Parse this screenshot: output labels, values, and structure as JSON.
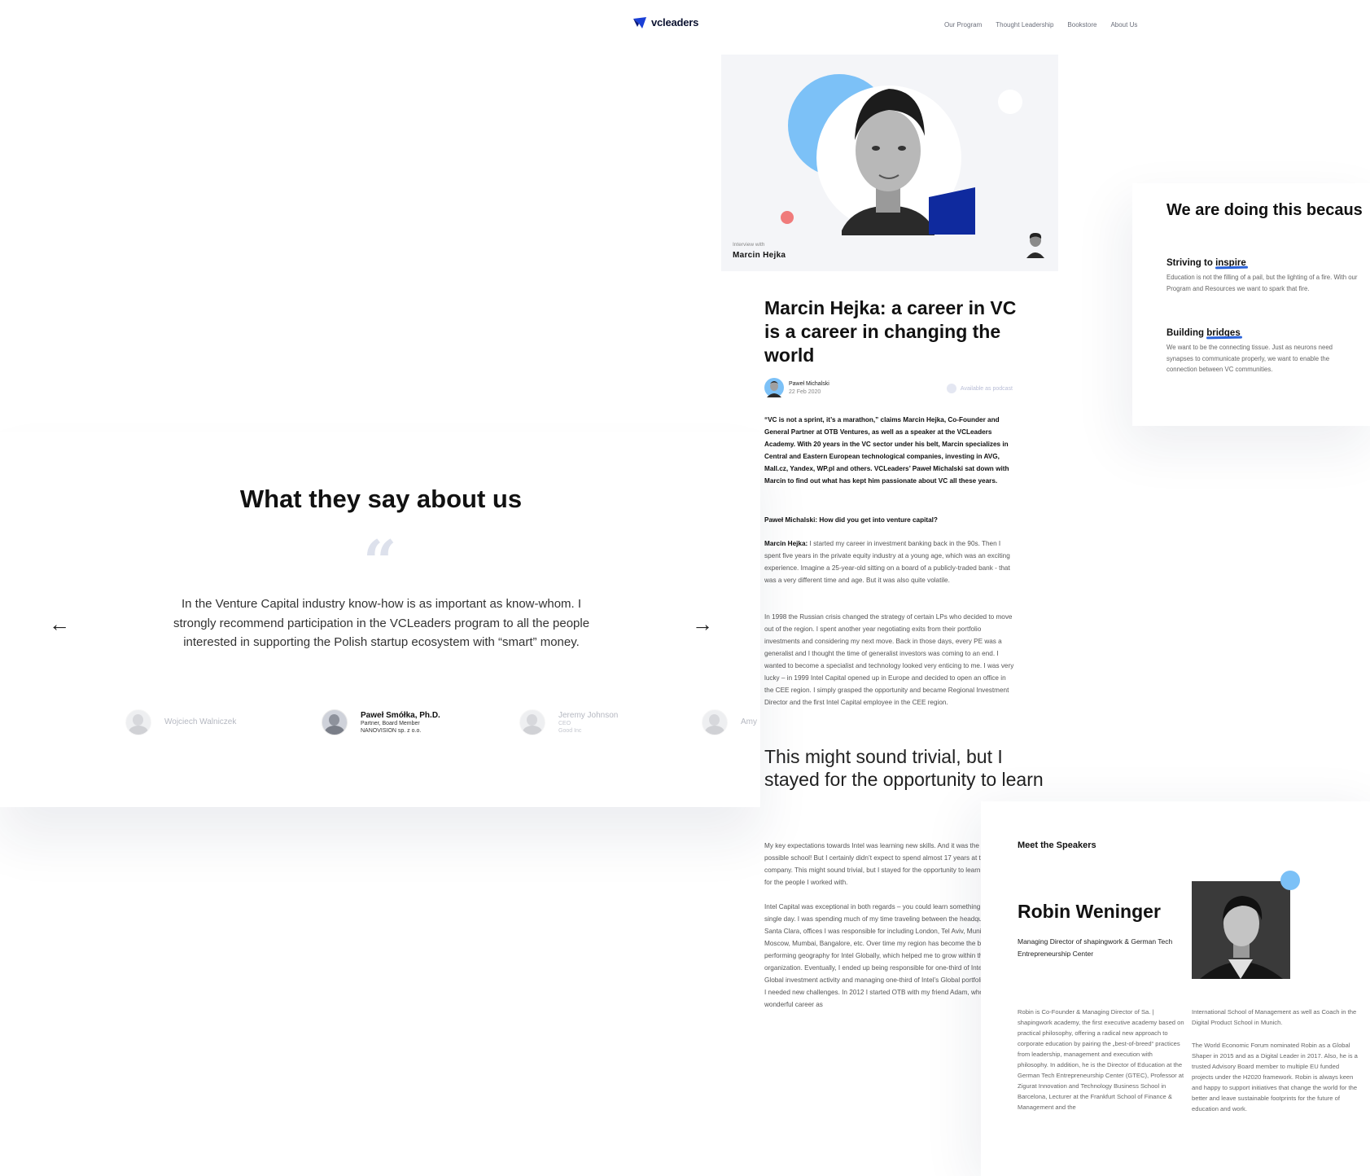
{
  "nav": {
    "brand": "vcleaders",
    "items": [
      "Our Program",
      "Thought Leadership",
      "Bookstore",
      "About Us"
    ]
  },
  "hero": {
    "label": "Interview with",
    "name": "Marcin Hejka"
  },
  "article": {
    "title": "Marcin Hejka: a career in VC is a career in changing the world",
    "author": "Paweł Michalski",
    "date": "22 Feb 2020",
    "podcast": "Available as podcast",
    "lead": "“VC is not a sprint, it’s a marathon,” claims Marcin Hejka, Co-Founder and General Partner at OTB Ventures, as well as a speaker at the VCLeaders Academy. With 20 years in the VC sector under his belt, Marcin specializes in Central and Eastern European technological companies, investing in AVG, Mall.cz, Yandex, WP.pl and others. VCLeaders’ Paweł Michalski sat down with Marcin to find out what has kept him passionate about VC all these years.",
    "question": "Paweł Michalski: How did you get into venture capital?",
    "answer_speaker": "Marcin Hejka:",
    "answer": " I started my career in investment banking back in the 90s. Then I spent five years in the private equity industry at a young age, which was an exciting experience. Imagine a 25-year-old sitting on a board of a publicly-traded bank - that was a very different time and age. But it was also quite volatile.",
    "para2": "In 1998 the Russian crisis changed the strategy of certain LPs who decided to move out of the region. I spent another year negotiating exits from their portfolio investments and considering my next move. Back in those days, every PE was a generalist and I thought the time of generalist investors was coming to an end. I wanted to become a specialist and technology looked very enticing to me. I was very lucky – in 1999 Intel Capital opened up in Europe and decided to open an office in the CEE region. I simply grasped the opportunity and became Regional Investment Director and the first Intel Capital employee in the CEE region.",
    "pull_quote": "This might sound trivial, but I stayed for the opportunity to learn",
    "para3": "My key expectations towards Intel was learning new skills. And it was the best possible school! But I certainly didn’t expect to spend almost 17 years at the company. This might sound trivial, but I stayed for the opportunity to learn and then for the people I worked with.",
    "para4": "Intel Capital was exceptional in both regards – you could learn something new every single day. I was spending much of my time traveling between the headquarters in Santa Clara, offices I was responsible for including London, Tel Aviv, Munich, Moscow, Mumbai, Bangalore, etc. Over time my region has become the best performing geography for Intel Globally, which helped me to grow within the organization. Eventually, I ended up being responsible for one-third of Intel Capital’s Global investment activity and managing one-third of Intel’s Global portfolio. I decided I needed new challenges. In 2012 I started OTB with my friend Adam, who had a wonderful career as"
  },
  "testimonials": {
    "title": "What they say about us",
    "quote_mark": "“",
    "text": "In the Venture Capital industry know-how is as important as know-whom. I strongly recommend participation in the VCLeaders program to all the people interested in supporting the Polish startup ecosystem with “smart” money.",
    "prev": "←",
    "next": "→",
    "people": [
      {
        "name": "Wojciech Walniczek",
        "role1": "",
        "role2": ""
      },
      {
        "name": "Paweł Smółka, Ph.D.",
        "role1": "Partner, Board Member",
        "role2": "NANOVISION sp. z o.o."
      },
      {
        "name": "Jeremy Johnson",
        "role1": "CEO",
        "role2": "Good Inc"
      },
      {
        "name": "Amy",
        "role1": "",
        "role2": ""
      }
    ]
  },
  "mission": {
    "title": "We are doing this becaus",
    "items": [
      {
        "prefix": "Striving to ",
        "highlight": "inspire",
        "text": "Education is not the filling of a pail, but the lighting of a fire. With our Program and Resources we want to spark that fire."
      },
      {
        "prefix": "Building ",
        "highlight": "bridges",
        "text": "We want to be the connecting tissue. Just as neurons need synapses to communicate properly, we want to enable the connection between VC communities."
      }
    ]
  },
  "speakers": {
    "heading": "Meet the Speakers",
    "name": "Robin Weninger",
    "role": "Managing Director of shapingwork & German Tech Entrepreneurship Center",
    "bio_left": "Robin is Co-Founder & Managing Director of Sa. | shapingwork academy, the first executive academy based on practical philosophy, offering a radical new approach to corporate education by pairing the „best-of-breed“ practices from leadership, management and execution with philosophy. In addition, he is the Director of Education at the German Tech Entrepreneurship Center (GTEC), Professor at Zigurat Innovation and Technology Business School in Barcelona, Lecturer at the Frankfurt School of Finance & Management and the",
    "bio_right_1": "International School of Management as well as Coach in the Digital Product School in Munich.",
    "bio_right_2": "The World Economic Forum nominated Robin as a Global Shaper in 2015 and as a Digital Leader in 2017. Also, he is a trusted Advisory Board member to multiple EU funded projects under the H2020 framework. Robin is always keen and happy to support initiatives that change the world for the better and leave sustainable footprints for the future of education and work."
  },
  "colors": {
    "accent_blue": "#7cc1f7",
    "navy": "#0f2a9e",
    "coral": "#f07b7b",
    "underline": "#2b63d9"
  }
}
